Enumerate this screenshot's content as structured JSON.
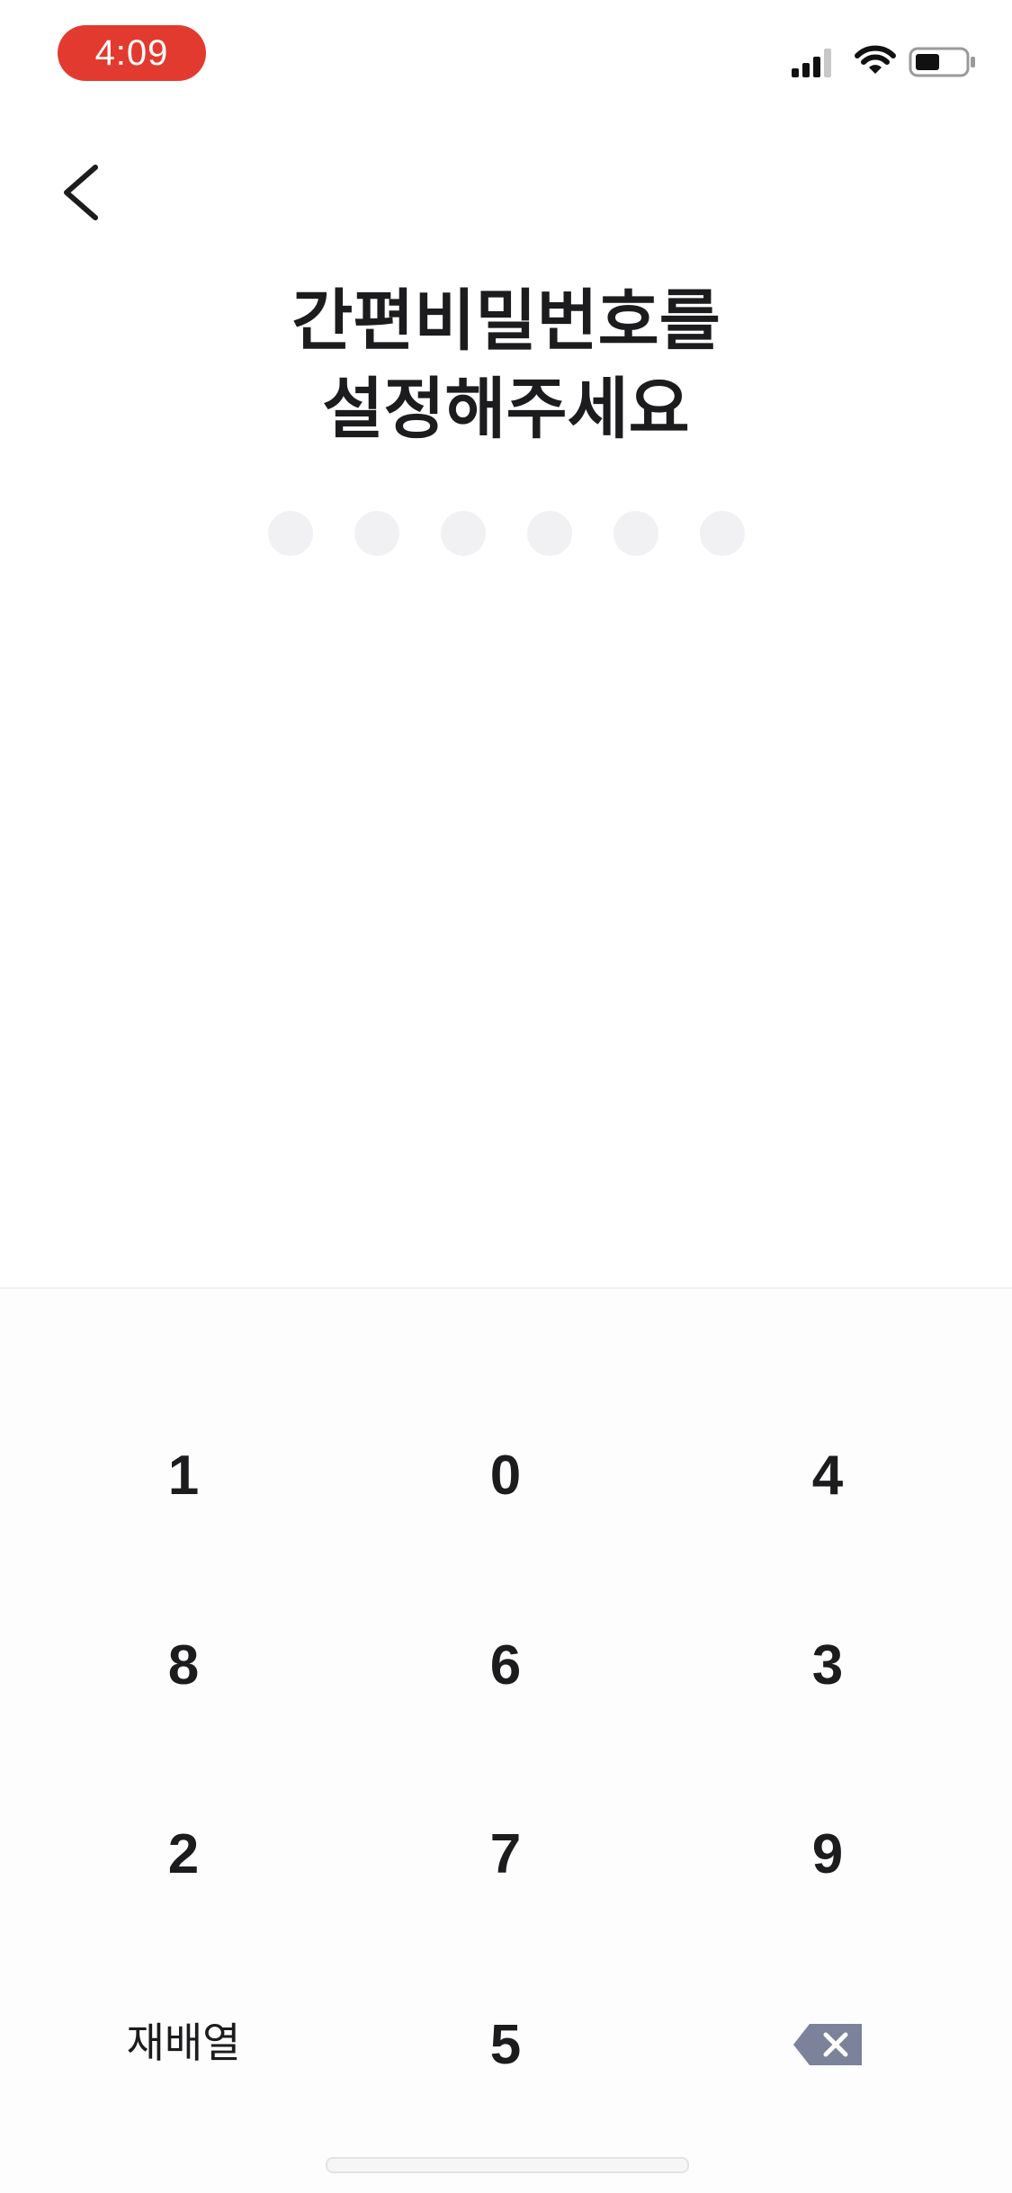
{
  "status_bar": {
    "time": "4:09",
    "time_pill_color": "#e33a2f",
    "icons": [
      "cellular-signal-icon",
      "wifi-icon",
      "battery-icon"
    ]
  },
  "header": {
    "back_icon": "chevron-left-icon"
  },
  "title": {
    "line1": "간편비밀번호를",
    "line2": "설정해주세요"
  },
  "pin": {
    "length": 6,
    "filled": 0,
    "empty_dot_color": "#f1f1f4"
  },
  "keypad": {
    "rows": [
      [
        "1",
        "0",
        "4"
      ],
      [
        "8",
        "6",
        "3"
      ],
      [
        "2",
        "7",
        "9"
      ]
    ],
    "shuffle_label": "재배열",
    "last_digit": "5",
    "delete_icon": "backspace-icon",
    "delete_icon_color": "#7b829a"
  }
}
